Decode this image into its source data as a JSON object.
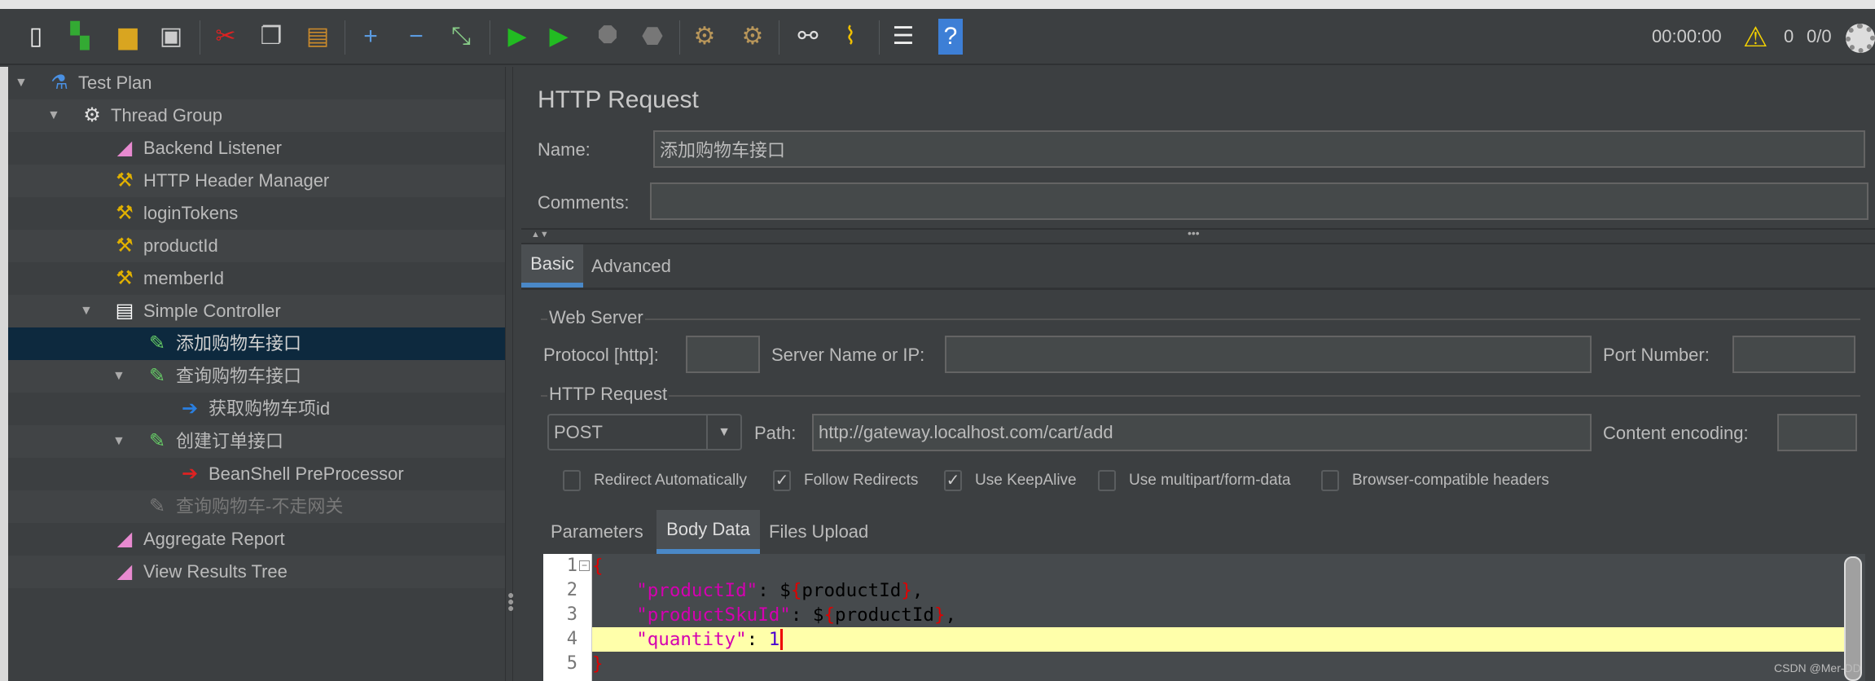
{
  "toolbar": {
    "icons": [
      "new-icon",
      "templates-icon",
      "open-icon",
      "save-icon",
      "cut-icon",
      "copy-icon",
      "paste-icon",
      "expand-icon",
      "collapse-icon",
      "toggle-icon",
      "start-icon",
      "start-no-pause-icon",
      "stop-icon",
      "shutdown-icon",
      "clear-icon",
      "clear-all-icon",
      "search-icon",
      "reset-search-icon",
      "function-helper-icon",
      "help-icon"
    ],
    "timer": "00:00:00",
    "warning_count": "0",
    "threads": "0/0"
  },
  "tree": [
    {
      "label": "Test Plan",
      "level": 0,
      "icon": "flask-icon",
      "expanded": true
    },
    {
      "label": "Thread Group",
      "level": 1,
      "icon": "gear-icon",
      "expanded": true
    },
    {
      "label": "Backend Listener",
      "level": 2,
      "icon": "listener-icon"
    },
    {
      "label": "HTTP Header Manager",
      "level": 2,
      "icon": "config-tools-icon"
    },
    {
      "label": "loginTokens",
      "level": 2,
      "icon": "config-tools-icon"
    },
    {
      "label": "productId",
      "level": 2,
      "icon": "config-tools-icon"
    },
    {
      "label": "memberId",
      "level": 2,
      "icon": "config-tools-icon"
    },
    {
      "label": "Simple Controller",
      "level": 2,
      "icon": "controller-icon",
      "expanded": true
    },
    {
      "label": "添加购物车接口",
      "level": 3,
      "icon": "sampler-pipette-icon",
      "selected": true
    },
    {
      "label": "查询购物车接口",
      "level": 3,
      "icon": "sampler-pipette-icon",
      "expanded": true
    },
    {
      "label": "获取购物车项id",
      "level": 4,
      "icon": "postprocessor-icon"
    },
    {
      "label": "创建订单接口",
      "level": 3,
      "icon": "sampler-pipette-icon",
      "expanded": true
    },
    {
      "label": "BeanShell PreProcessor",
      "level": 4,
      "icon": "preprocessor-icon"
    },
    {
      "label": "查询购物车-不走网关",
      "level": 3,
      "icon": "sampler-pipette-icon",
      "disabled": true
    },
    {
      "label": "Aggregate Report",
      "level": 2,
      "icon": "listener-icon"
    },
    {
      "label": "View Results Tree",
      "level": 2,
      "icon": "listener-icon"
    }
  ],
  "panel": {
    "title": "HTTP Request",
    "name_label": "Name:",
    "name_value": "添加购物车接口",
    "comments_label": "Comments:",
    "comments_value": "",
    "tabs": [
      "Basic",
      "Advanced"
    ],
    "web_server": {
      "group": "Web Server",
      "protocol_label": "Protocol [http]:",
      "protocol_value": "",
      "server_label": "Server Name or IP:",
      "server_value": "",
      "port_label": "Port Number:",
      "port_value": ""
    },
    "http_request": {
      "group": "HTTP Request",
      "method": "POST",
      "path_label": "Path:",
      "path_value": "http://gateway.localhost.com/cart/add",
      "encoding_label": "Content encoding:",
      "encoding_value": ""
    },
    "checkboxes": [
      {
        "label": "Redirect Automatically",
        "checked": false
      },
      {
        "label": "Follow Redirects",
        "checked": true
      },
      {
        "label": "Use KeepAlive",
        "checked": true
      },
      {
        "label": "Use multipart/form-data",
        "checked": false
      },
      {
        "label": "Browser-compatible headers",
        "checked": false
      }
    ],
    "subtabs": [
      "Parameters",
      "Body Data",
      "Files Upload"
    ],
    "body_lines": [
      "{",
      "    \"productId\": ${productId},",
      "    \"productSkuId\": ${productId},",
      "    \"quantity\": 1",
      "}"
    ],
    "line_numbers": [
      "1",
      "2",
      "3",
      "4",
      "5"
    ]
  },
  "watermark": "CSDN @Mer-DD",
  "colors": {
    "bg": "#3c3f41",
    "selected": "#0d293e",
    "accent": "#4a88c7",
    "highlight_line": "#ffffaa"
  }
}
